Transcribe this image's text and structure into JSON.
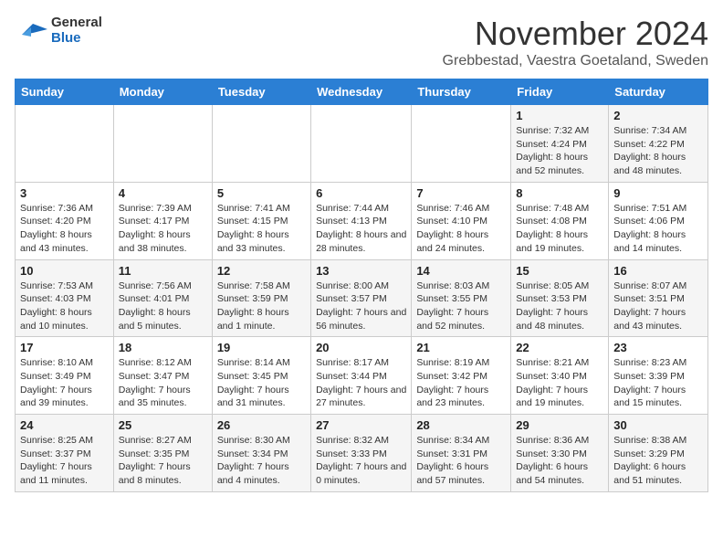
{
  "header": {
    "logo_line1": "General",
    "logo_line2": "Blue",
    "month": "November 2024",
    "location": "Grebbestad, Vaestra Goetaland, Sweden"
  },
  "weekdays": [
    "Sunday",
    "Monday",
    "Tuesday",
    "Wednesday",
    "Thursday",
    "Friday",
    "Saturday"
  ],
  "weeks": [
    [
      {
        "day": "",
        "info": ""
      },
      {
        "day": "",
        "info": ""
      },
      {
        "day": "",
        "info": ""
      },
      {
        "day": "",
        "info": ""
      },
      {
        "day": "",
        "info": ""
      },
      {
        "day": "1",
        "info": "Sunrise: 7:32 AM\nSunset: 4:24 PM\nDaylight: 8 hours and 52 minutes."
      },
      {
        "day": "2",
        "info": "Sunrise: 7:34 AM\nSunset: 4:22 PM\nDaylight: 8 hours and 48 minutes."
      }
    ],
    [
      {
        "day": "3",
        "info": "Sunrise: 7:36 AM\nSunset: 4:20 PM\nDaylight: 8 hours and 43 minutes."
      },
      {
        "day": "4",
        "info": "Sunrise: 7:39 AM\nSunset: 4:17 PM\nDaylight: 8 hours and 38 minutes."
      },
      {
        "day": "5",
        "info": "Sunrise: 7:41 AM\nSunset: 4:15 PM\nDaylight: 8 hours and 33 minutes."
      },
      {
        "day": "6",
        "info": "Sunrise: 7:44 AM\nSunset: 4:13 PM\nDaylight: 8 hours and 28 minutes."
      },
      {
        "day": "7",
        "info": "Sunrise: 7:46 AM\nSunset: 4:10 PM\nDaylight: 8 hours and 24 minutes."
      },
      {
        "day": "8",
        "info": "Sunrise: 7:48 AM\nSunset: 4:08 PM\nDaylight: 8 hours and 19 minutes."
      },
      {
        "day": "9",
        "info": "Sunrise: 7:51 AM\nSunset: 4:06 PM\nDaylight: 8 hours and 14 minutes."
      }
    ],
    [
      {
        "day": "10",
        "info": "Sunrise: 7:53 AM\nSunset: 4:03 PM\nDaylight: 8 hours and 10 minutes."
      },
      {
        "day": "11",
        "info": "Sunrise: 7:56 AM\nSunset: 4:01 PM\nDaylight: 8 hours and 5 minutes."
      },
      {
        "day": "12",
        "info": "Sunrise: 7:58 AM\nSunset: 3:59 PM\nDaylight: 8 hours and 1 minute."
      },
      {
        "day": "13",
        "info": "Sunrise: 8:00 AM\nSunset: 3:57 PM\nDaylight: 7 hours and 56 minutes."
      },
      {
        "day": "14",
        "info": "Sunrise: 8:03 AM\nSunset: 3:55 PM\nDaylight: 7 hours and 52 minutes."
      },
      {
        "day": "15",
        "info": "Sunrise: 8:05 AM\nSunset: 3:53 PM\nDaylight: 7 hours and 48 minutes."
      },
      {
        "day": "16",
        "info": "Sunrise: 8:07 AM\nSunset: 3:51 PM\nDaylight: 7 hours and 43 minutes."
      }
    ],
    [
      {
        "day": "17",
        "info": "Sunrise: 8:10 AM\nSunset: 3:49 PM\nDaylight: 7 hours and 39 minutes."
      },
      {
        "day": "18",
        "info": "Sunrise: 8:12 AM\nSunset: 3:47 PM\nDaylight: 7 hours and 35 minutes."
      },
      {
        "day": "19",
        "info": "Sunrise: 8:14 AM\nSunset: 3:45 PM\nDaylight: 7 hours and 31 minutes."
      },
      {
        "day": "20",
        "info": "Sunrise: 8:17 AM\nSunset: 3:44 PM\nDaylight: 7 hours and 27 minutes."
      },
      {
        "day": "21",
        "info": "Sunrise: 8:19 AM\nSunset: 3:42 PM\nDaylight: 7 hours and 23 minutes."
      },
      {
        "day": "22",
        "info": "Sunrise: 8:21 AM\nSunset: 3:40 PM\nDaylight: 7 hours and 19 minutes."
      },
      {
        "day": "23",
        "info": "Sunrise: 8:23 AM\nSunset: 3:39 PM\nDaylight: 7 hours and 15 minutes."
      }
    ],
    [
      {
        "day": "24",
        "info": "Sunrise: 8:25 AM\nSunset: 3:37 PM\nDaylight: 7 hours and 11 minutes."
      },
      {
        "day": "25",
        "info": "Sunrise: 8:27 AM\nSunset: 3:35 PM\nDaylight: 7 hours and 8 minutes."
      },
      {
        "day": "26",
        "info": "Sunrise: 8:30 AM\nSunset: 3:34 PM\nDaylight: 7 hours and 4 minutes."
      },
      {
        "day": "27",
        "info": "Sunrise: 8:32 AM\nSunset: 3:33 PM\nDaylight: 7 hours and 0 minutes."
      },
      {
        "day": "28",
        "info": "Sunrise: 8:34 AM\nSunset: 3:31 PM\nDaylight: 6 hours and 57 minutes."
      },
      {
        "day": "29",
        "info": "Sunrise: 8:36 AM\nSunset: 3:30 PM\nDaylight: 6 hours and 54 minutes."
      },
      {
        "day": "30",
        "info": "Sunrise: 8:38 AM\nSunset: 3:29 PM\nDaylight: 6 hours and 51 minutes."
      }
    ]
  ]
}
